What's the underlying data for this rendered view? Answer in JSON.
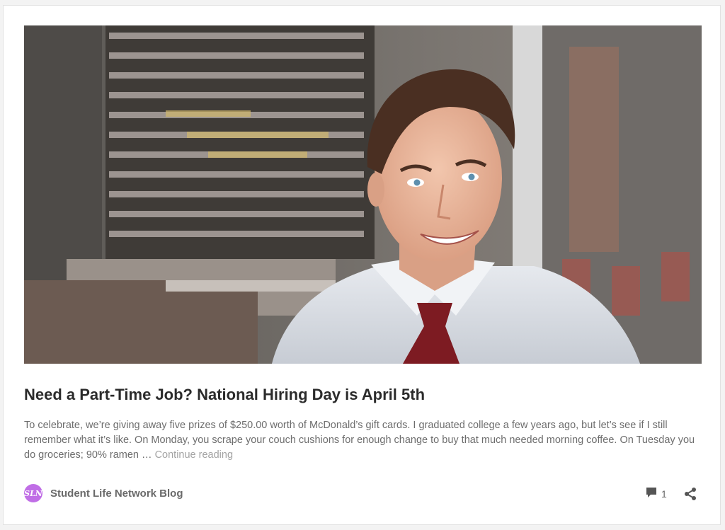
{
  "post": {
    "image_alt": "Smiling young man in a white shirt and red tie inside a restaurant",
    "title": "Need a Part-Time Job? National Hiring Day is April 5th",
    "excerpt": "To celebrate, we’re giving away five prizes of $250.00 worth of McDonald’s gift cards. I graduated college a few years ago, but let’s see if I still remember what it’s like. On Monday, you scrape your couch cushions for enough change to buy that much needed morning coffee. On Tuesday you do groceries; 90% ramen … ",
    "continue_label": "Continue reading"
  },
  "footer": {
    "avatar_text": "SLN",
    "author": "Student Life Network Blog",
    "comment_count": "1",
    "comment_icon": "comment-icon",
    "share_icon": "share-icon"
  },
  "colors": {
    "avatar": "#c06ee6",
    "title": "#2b2b2b",
    "excerpt": "#6d6d6d",
    "continue": "#a3a3a3"
  }
}
